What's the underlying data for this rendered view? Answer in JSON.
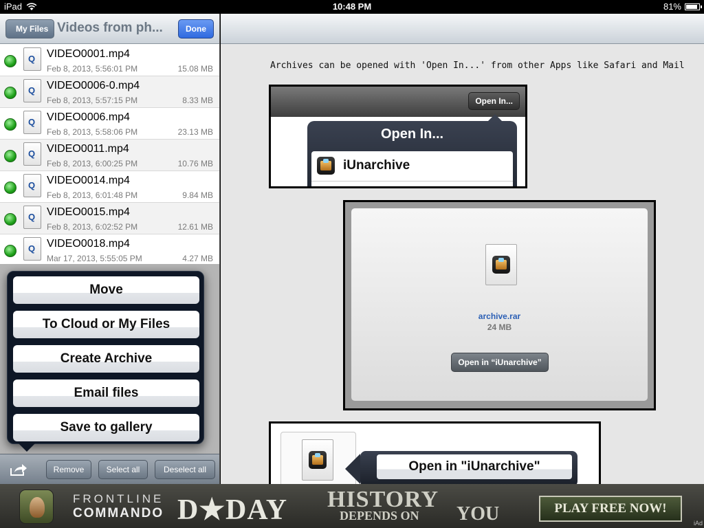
{
  "status_bar": {
    "device": "iPad",
    "time": "10:48 PM",
    "battery": "81%"
  },
  "left_nav": {
    "back_label": "My Files",
    "title": "Videos from ph...",
    "done_label": "Done"
  },
  "files": [
    {
      "name": "VIDEO0001.mp4",
      "date": "Feb 8, 2013, 5:56:01 PM",
      "size": "15.08 MB"
    },
    {
      "name": "VIDEO0006-0.mp4",
      "date": "Feb 8, 2013, 5:57:15 PM",
      "size": "8.33 MB"
    },
    {
      "name": "VIDEO0006.mp4",
      "date": "Feb 8, 2013, 5:58:06 PM",
      "size": "23.13 MB"
    },
    {
      "name": "VIDEO0011.mp4",
      "date": "Feb 8, 2013, 6:00:25 PM",
      "size": "10.76 MB"
    },
    {
      "name": "VIDEO0014.mp4",
      "date": "Feb 8, 2013, 6:01:48 PM",
      "size": "9.84 MB"
    },
    {
      "name": "VIDEO0015.mp4",
      "date": "Feb 8, 2013, 6:02:52 PM",
      "size": "12.61 MB"
    },
    {
      "name": "VIDEO0018.mp4",
      "date": "Mar 17, 2013, 5:55:05 PM",
      "size": "4.27 MB"
    }
  ],
  "popover_menu": {
    "move": "Move",
    "to_cloud": "To Cloud or My Files",
    "create_archive": "Create Archive",
    "email_files": "Email files",
    "save_gallery": "Save to gallery"
  },
  "bottom_toolbar": {
    "remove": "Remove",
    "select_all": "Select all",
    "deselect_all": "Deselect all"
  },
  "help": {
    "text": "Archives can be opened with 'Open In...' from other Apps like Safari and Mail",
    "demo1_button": "Open In...",
    "demo1_popover_title": "Open In...",
    "demo1_app": "iUnarchive",
    "demo2_filename": "archive.rar",
    "demo2_size": "24 MB",
    "demo2_button": "Open in “iUnarchive”",
    "demo3_label": "Open in \"iUnarchive\""
  },
  "ad": {
    "line1": "FRONTLINE",
    "line2": "COMMANDO",
    "brand": "D★DAY",
    "history": "HISTORY",
    "depends_on": "DEPENDS ON",
    "you": "YOU",
    "cta": "PLAY FREE NOW!",
    "iad": "iAd"
  }
}
